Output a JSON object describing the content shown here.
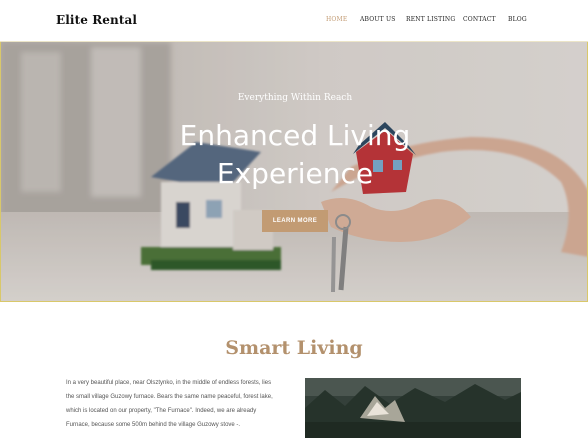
{
  "header": {
    "brand": "Elite Rental",
    "nav": [
      {
        "label": "HOME",
        "active": true
      },
      {
        "label": "ABOUT US",
        "active": false
      },
      {
        "label": "RENT LISTING",
        "active": false
      },
      {
        "label": "CONTACT",
        "active": false
      },
      {
        "label": "BLOG",
        "active": false
      }
    ]
  },
  "hero": {
    "kicker": "Everything Within Reach",
    "title_line1": "Enhanced Living",
    "title_line2": "Experience",
    "button": "LEARN MORE"
  },
  "section": {
    "title": "Smart Living",
    "paragraph_lines": [
      "In a very beautiful place, near Olsztynko, in the middle of endless forests, lies",
      "the small village Guzowy furnace. Bears the same name peaceful, forest lake,",
      "which is located on our property, \"The Furnace\". Indeed, we are already",
      "Furnace, because some 500m behind the village Guzowy stove -."
    ]
  },
  "colors": {
    "accent": "#c29b73",
    "section_title": "#b3916d",
    "hero_border": "#d9c86a"
  }
}
